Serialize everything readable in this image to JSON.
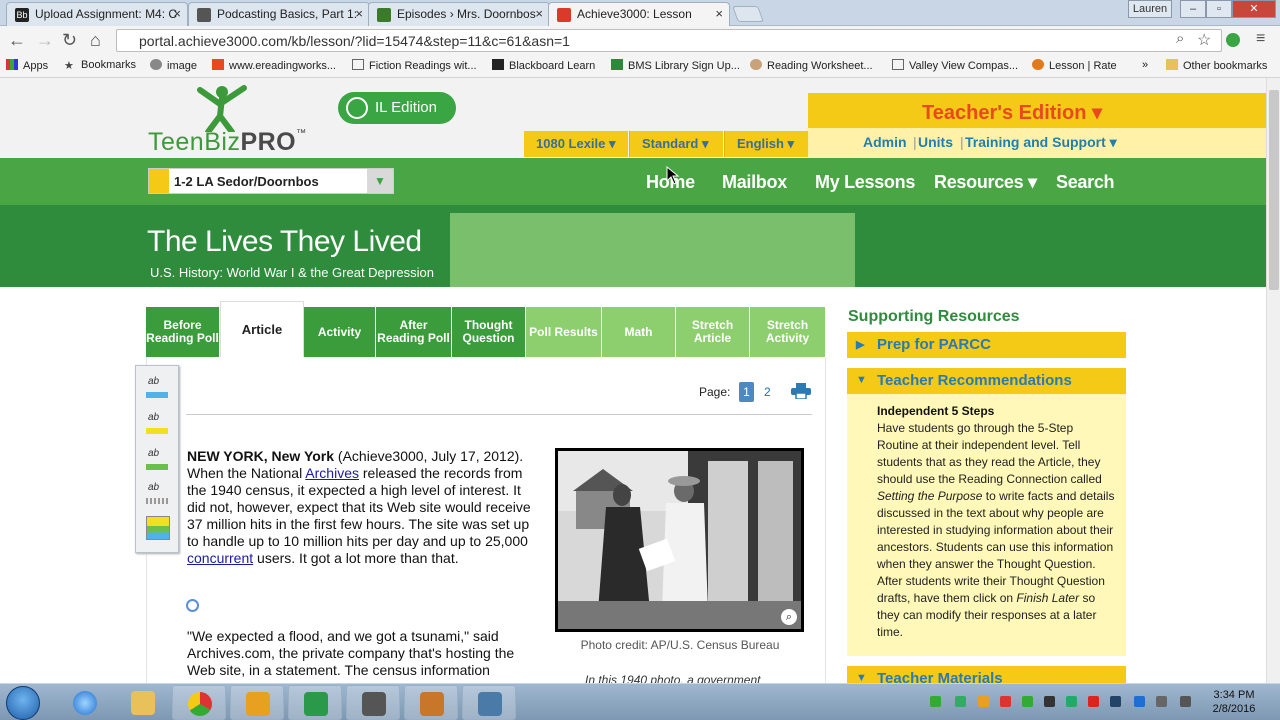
{
  "browser": {
    "tabs": [
      {
        "title": "Upload Assignment: M4: C",
        "favicon": "Bb"
      },
      {
        "title": "Podcasting Basics, Part 1:",
        "favicon": "document-icon"
      },
      {
        "title": "Episodes › Mrs. Doornbos",
        "favicon": "podcast-icon"
      },
      {
        "title": "Achieve3000: Lesson",
        "favicon": "achieve-icon"
      }
    ],
    "user_badge": "Lauren",
    "url": "portal.achieve3000.com/kb/lesson/?lid=15474&step=11&c=61&asn=1",
    "bookmarks": [
      "Apps",
      "Bookmarks",
      "image",
      "www.ereadingworks...",
      "Fiction Readings wit...",
      "Blackboard Learn",
      "BMS Library Sign Up...",
      "Reading Worksheet...",
      "Valley View Compas...",
      "Lesson | Rate",
      "»",
      "Other bookmarks"
    ]
  },
  "header": {
    "logo_text_main": "TeenBiz",
    "logo_text_pro": "PRO",
    "logo_tm": "™",
    "edition_label": "IL Edition",
    "teacher_edition": "Teacher's Edition ▾",
    "lexile": "1080 Lexile ▾",
    "level": "Standard ▾",
    "language": "English ▾",
    "admin_links": [
      "Admin",
      "Units",
      "Training and Support ▾"
    ]
  },
  "nav": {
    "class_select": "1-2 LA Sedor/Doornbos",
    "links": [
      "Home",
      "Mailbox",
      "My Lessons",
      "Resources ▾",
      "Search"
    ]
  },
  "lesson": {
    "title": "The Lives They Lived",
    "subtitle": "U.S. History: World War I & the Great Depression",
    "tabs": [
      {
        "label": "Before Reading Poll",
        "style": "dark"
      },
      {
        "label": "Article",
        "style": "selected"
      },
      {
        "label": "Activity",
        "style": "dark"
      },
      {
        "label": "After Reading Poll",
        "style": "dark"
      },
      {
        "label": "Thought Question",
        "style": "dark"
      },
      {
        "label": "Poll Results",
        "style": "light"
      },
      {
        "label": "Math",
        "style": "light"
      },
      {
        "label": "Stretch Article",
        "style": "light"
      },
      {
        "label": "Stretch Activity",
        "style": "light"
      }
    ]
  },
  "article": {
    "page_label": "Page:",
    "pages": [
      "1",
      "2"
    ],
    "para1_dateline": "NEW YORK, New York",
    "para1_source": " (Achieve3000, July 17, 2012). When the National ",
    "para1_link1": "Archives",
    "para1_mid": " released the records from the 1940 census, it expected a high level of interest. It did not, however, expect that its Web site would receive 37 million hits in the first few hours. The site was set up to handle up to 10 million hits per day and up to 25,000 ",
    "para1_link2": "concurrent",
    "para1_end": " users. It got a lot more than that.",
    "para2": "\"We expected a flood, and we got a tsunami,\" said Archives.com, the private company that's hosting the Web site, in a statement. The census information",
    "photo_credit": "Photo credit: AP/U.S. Census Bureau",
    "photo_caption": "In this 1940 photo, a government"
  },
  "sidebar": {
    "title": "Supporting Resources",
    "sections": [
      {
        "label": "Prep for PARCC",
        "expanded": false
      },
      {
        "label": "Teacher Recommendations",
        "expanded": true
      },
      {
        "label": "Teacher Materials",
        "expanded": true
      }
    ],
    "reco_heading": "Independent 5 Steps",
    "reco_text_1": "Have students go through the 5-Step Routine at their independent level. Tell students that as they read the Article, they should use the Reading Connection called ",
    "reco_italic_1": "Setting the Purpose",
    "reco_text_2": " to write facts and details discussed in the text about why people are interested in studying information about their ancestors. Students can use this information when they answer the Thought Question. After students write their Thought Question drafts, have them click on ",
    "reco_italic_2": "Finish Later",
    "reco_text_3": " so they can modify their responses at a later time."
  },
  "taskbar": {
    "time": "3:34 PM",
    "date": "2/8/2016"
  },
  "colors": {
    "brand_green": "#4aa545",
    "banner_green": "#2f8c3c",
    "teacher_yellow": "#f4ca16",
    "teacher_orange": "#e8491d",
    "link_blue": "#2a7ab3"
  }
}
